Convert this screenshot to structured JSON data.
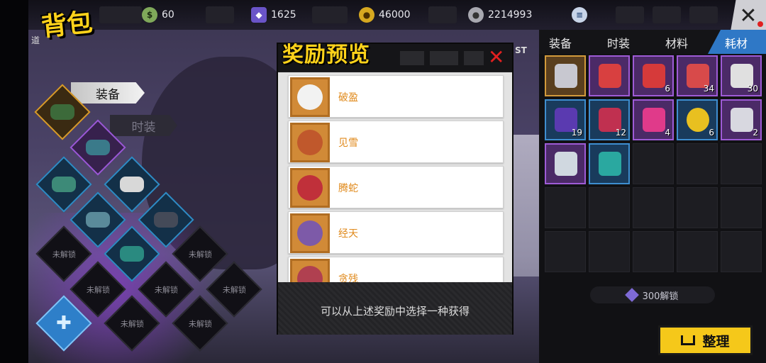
{
  "header": {
    "title": "背包",
    "resources": [
      {
        "icon": "cash-icon",
        "value": "60"
      },
      {
        "icon": "purple-crystal-icon",
        "value": "1625"
      },
      {
        "icon": "gold-coin-icon",
        "value": "46000"
      },
      {
        "icon": "silver-coin-icon",
        "value": "2214993"
      }
    ]
  },
  "left": {
    "tab_equip": "装备",
    "tab_fashion": "时装",
    "side_label": "道",
    "locked_label": "未解锁"
  },
  "modal": {
    "title": "奖励预览",
    "items": [
      {
        "name": "破盈",
        "color": "#f2f2f2"
      },
      {
        "name": "见雪",
        "color": "#c0582c"
      },
      {
        "name": "腾蛇",
        "color": "#c0303a"
      },
      {
        "name": "经天",
        "color": "#7d5aa8"
      },
      {
        "name": "贪残",
        "color": "#b04050"
      }
    ],
    "footer": "可以从上述奖励中选择一种获得"
  },
  "right": {
    "tabs": [
      "装备",
      "时装",
      "材料",
      "耗材"
    ],
    "active_tab": "耗材",
    "st_label": "ST",
    "items": [
      {
        "rarity": "gold",
        "color": "#c8c8d0",
        "count": ""
      },
      {
        "rarity": "purple",
        "color": "#d84040",
        "count": ""
      },
      {
        "rarity": "purple",
        "color": "#d63a3a",
        "count": "6"
      },
      {
        "rarity": "purple",
        "color": "#d84a4a",
        "count": "34"
      },
      {
        "rarity": "purple",
        "color": "#e0e0e0",
        "count": "30"
      },
      {
        "rarity": "blue",
        "color": "#5a3ab0",
        "count": "19"
      },
      {
        "rarity": "blue",
        "color": "#c03050",
        "count": "12"
      },
      {
        "rarity": "purple",
        "color": "#e03a8a",
        "count": "4"
      },
      {
        "rarity": "blue",
        "color": "#e8c020",
        "count": "6"
      },
      {
        "rarity": "purple",
        "color": "#d8d8e0",
        "count": "2"
      },
      {
        "rarity": "purple",
        "color": "#d0d8e0",
        "count": ""
      },
      {
        "rarity": "blue",
        "color": "#2aa8a0",
        "count": ""
      }
    ],
    "unlock_label": "300解锁",
    "sort_label": "整理"
  }
}
